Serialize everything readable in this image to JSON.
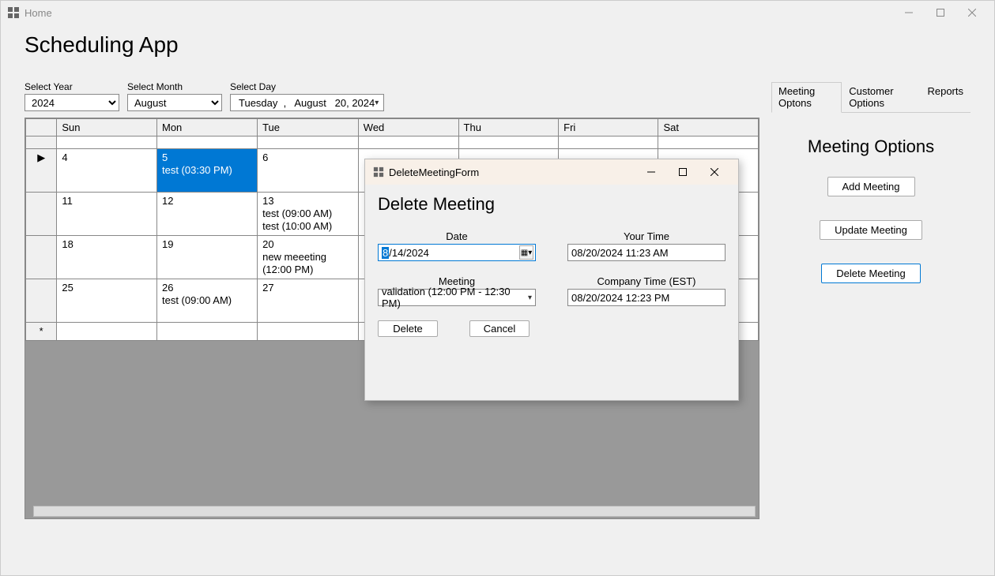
{
  "window": {
    "title": "Home"
  },
  "page_title": "Scheduling App",
  "selectors": {
    "year_label": "Select Year",
    "year_value": "2024",
    "month_label": "Select Month",
    "month_value": "August",
    "day_label": "Select Day",
    "day_value": "Tuesday  ,   August   20, 2024"
  },
  "calendar": {
    "headers": [
      "",
      "Sun",
      "Mon",
      "Tue",
      "Wed",
      "Thu",
      "Fri",
      "Sat"
    ],
    "rows": [
      {
        "marker": "",
        "cells": [
          "",
          "",
          "",
          "",
          "",
          "",
          ""
        ]
      },
      {
        "marker": "▶",
        "cells": [
          "4",
          "5\ntest (03:30 PM)",
          "6",
          "",
          "",
          "",
          ""
        ],
        "selected_col": 1
      },
      {
        "marker": "",
        "cells": [
          "11",
          "12",
          "13\ntest (09:00 AM)\ntest (10:00 AM)",
          "",
          "",
          "",
          ""
        ]
      },
      {
        "marker": "",
        "cells": [
          "18",
          "19",
          "20\nnew meeeting (12:00 PM)",
          "",
          "",
          "",
          ""
        ]
      },
      {
        "marker": "",
        "cells": [
          "25",
          "26\ntest (09:00 AM)",
          "27",
          "",
          "",
          "",
          ""
        ]
      },
      {
        "marker": "*",
        "cells": [
          "",
          "",
          "",
          "",
          "",
          "",
          ""
        ]
      }
    ]
  },
  "tabs": {
    "items": [
      "Meeting Optons",
      "Customer Options",
      "Reports"
    ],
    "active": 0
  },
  "meeting_options": {
    "title": "Meeting Options",
    "add": "Add Meeting",
    "update": "Update Meeting",
    "delete": "Delete Meeting"
  },
  "dialog": {
    "window_title": "DeleteMeetingForm",
    "heading": "Delete Meeting",
    "date_label": "Date",
    "date_value_pre": "8",
    "date_value_post": "/14/2024",
    "your_time_label": "Your Time",
    "your_time_value": "08/20/2024 11:23 AM",
    "meeting_label": "Meeting",
    "meeting_value": "validation (12:00 PM - 12:30 PM)",
    "company_time_label": "Company Time (EST)",
    "company_time_value": "08/20/2024 12:23 PM",
    "delete_btn": "Delete",
    "cancel_btn": "Cancel"
  }
}
